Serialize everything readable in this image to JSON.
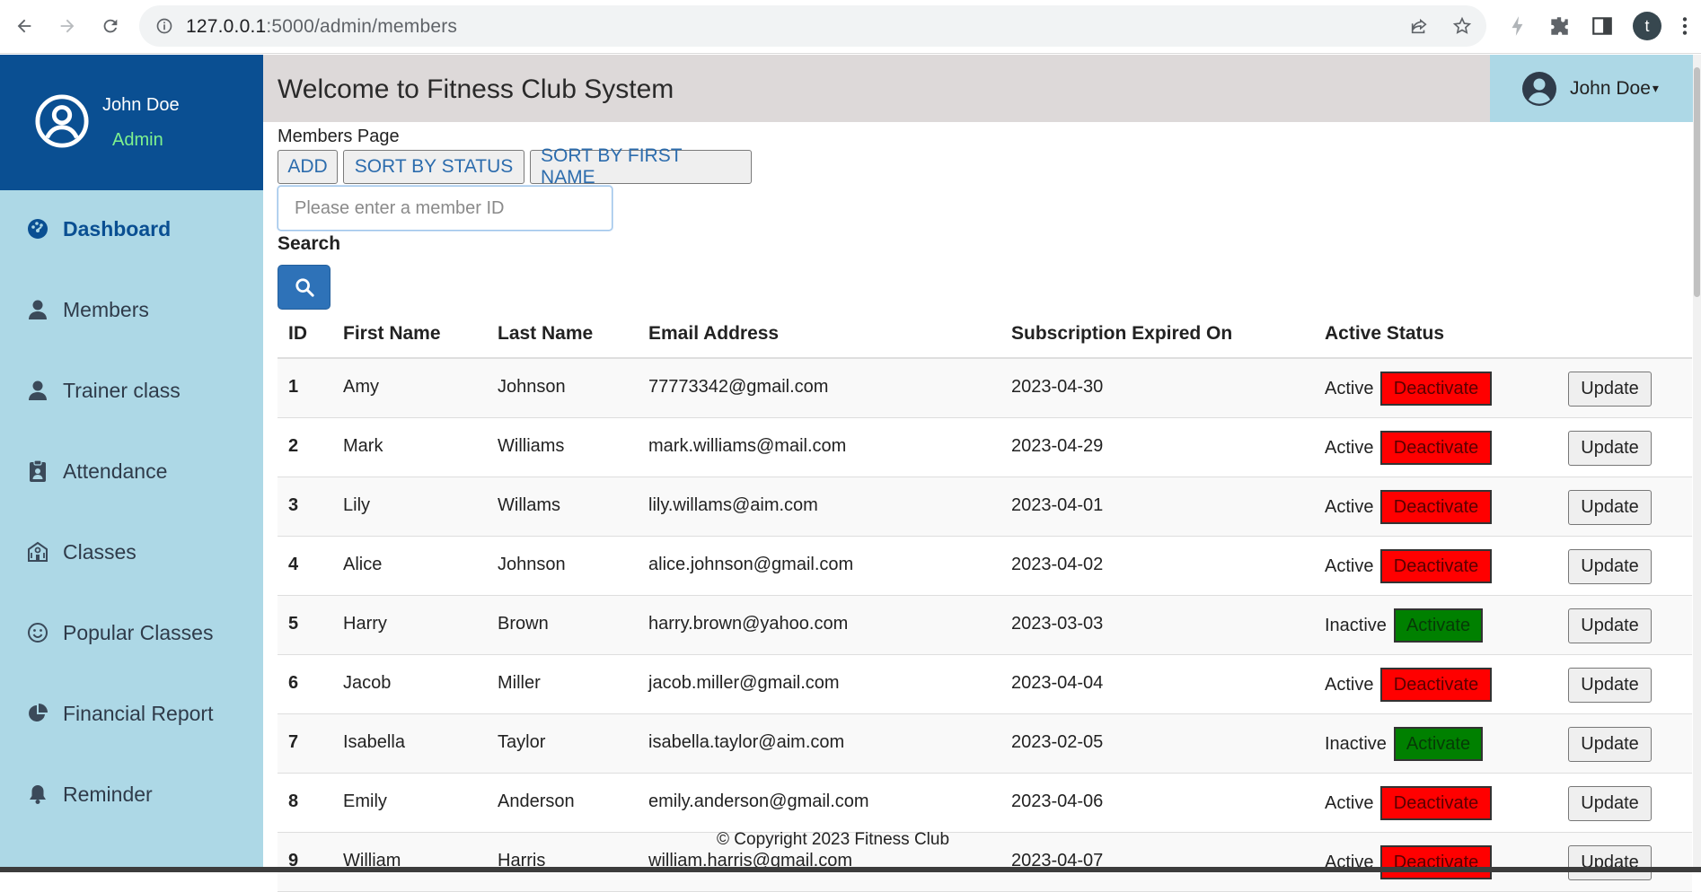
{
  "browser": {
    "url_host": "127.0.0.1",
    "url_rest": ":5000/admin/members",
    "profile_initial": "t"
  },
  "sidebar": {
    "username": "John Doe",
    "role": "Admin",
    "items": [
      {
        "label": "Dashboard",
        "icon": "palette-icon"
      },
      {
        "label": "Members",
        "icon": "user-icon"
      },
      {
        "label": "Trainer class",
        "icon": "user-icon"
      },
      {
        "label": "Attendance",
        "icon": "clipboard-user-icon"
      },
      {
        "label": "Classes",
        "icon": "school-icon"
      },
      {
        "label": "Popular Classes",
        "icon": "smile-icon"
      },
      {
        "label": "Financial Report",
        "icon": "pie-chart-icon"
      },
      {
        "label": "Reminder",
        "icon": "bell-icon"
      }
    ]
  },
  "header": {
    "title": "Welcome to Fitness Club System",
    "user_name": "John Doe"
  },
  "main": {
    "page_label": "Members Page",
    "buttons": {
      "add": "ADD",
      "sort_status": "SORT BY STATUS",
      "sort_first_name": "SORT BY FIRST NAME"
    },
    "search": {
      "placeholder": "Please enter a member ID",
      "label": "Search"
    },
    "table": {
      "columns": [
        "ID",
        "First Name",
        "Last Name",
        "Email Address",
        "Subscription Expired On",
        "Active Status"
      ],
      "rows": [
        {
          "id": "1",
          "first": "Amy",
          "last": "Johnson",
          "email": "77773342@gmail.com",
          "expires": "2023-04-30",
          "status": "Active",
          "action": "Deactivate",
          "update": "Update"
        },
        {
          "id": "2",
          "first": "Mark",
          "last": "Williams",
          "email": "mark.williams@mail.com",
          "expires": "2023-04-29",
          "status": "Active",
          "action": "Deactivate",
          "update": "Update"
        },
        {
          "id": "3",
          "first": "Lily",
          "last": "Willams",
          "email": "lily.willams@aim.com",
          "expires": "2023-04-01",
          "status": "Active",
          "action": "Deactivate",
          "update": "Update"
        },
        {
          "id": "4",
          "first": "Alice",
          "last": "Johnson",
          "email": "alice.johnson@gmail.com",
          "expires": "2023-04-02",
          "status": "Active",
          "action": "Deactivate",
          "update": "Update"
        },
        {
          "id": "5",
          "first": "Harry",
          "last": "Brown",
          "email": "harry.brown@yahoo.com",
          "expires": "2023-03-03",
          "status": "Inactive",
          "action": "Activate",
          "update": "Update"
        },
        {
          "id": "6",
          "first": "Jacob",
          "last": "Miller",
          "email": "jacob.miller@gmail.com",
          "expires": "2023-04-04",
          "status": "Active",
          "action": "Deactivate",
          "update": "Update"
        },
        {
          "id": "7",
          "first": "Isabella",
          "last": "Taylor",
          "email": "isabella.taylor@aim.com",
          "expires": "2023-02-05",
          "status": "Inactive",
          "action": "Activate",
          "update": "Update"
        },
        {
          "id": "8",
          "first": "Emily",
          "last": "Anderson",
          "email": "emily.anderson@gmail.com",
          "expires": "2023-04-06",
          "status": "Active",
          "action": "Deactivate",
          "update": "Update"
        },
        {
          "id": "9",
          "first": "William",
          "last": "Harris",
          "email": "william.harris@gmail.com",
          "expires": "2023-04-07",
          "status": "Active",
          "action": "Deactivate",
          "update": "Update"
        }
      ]
    }
  },
  "footer": {
    "copyright": "© Copyright 2023 Fitness Club"
  },
  "colors": {
    "sidebar_bg": "#add8e6",
    "sidebar_header_bg": "#0a4f92",
    "role_text": "#7ef28e",
    "deactivate_bg": "#ff0000",
    "activate_bg": "#008000",
    "search_button_bg": "#2e72b8"
  }
}
